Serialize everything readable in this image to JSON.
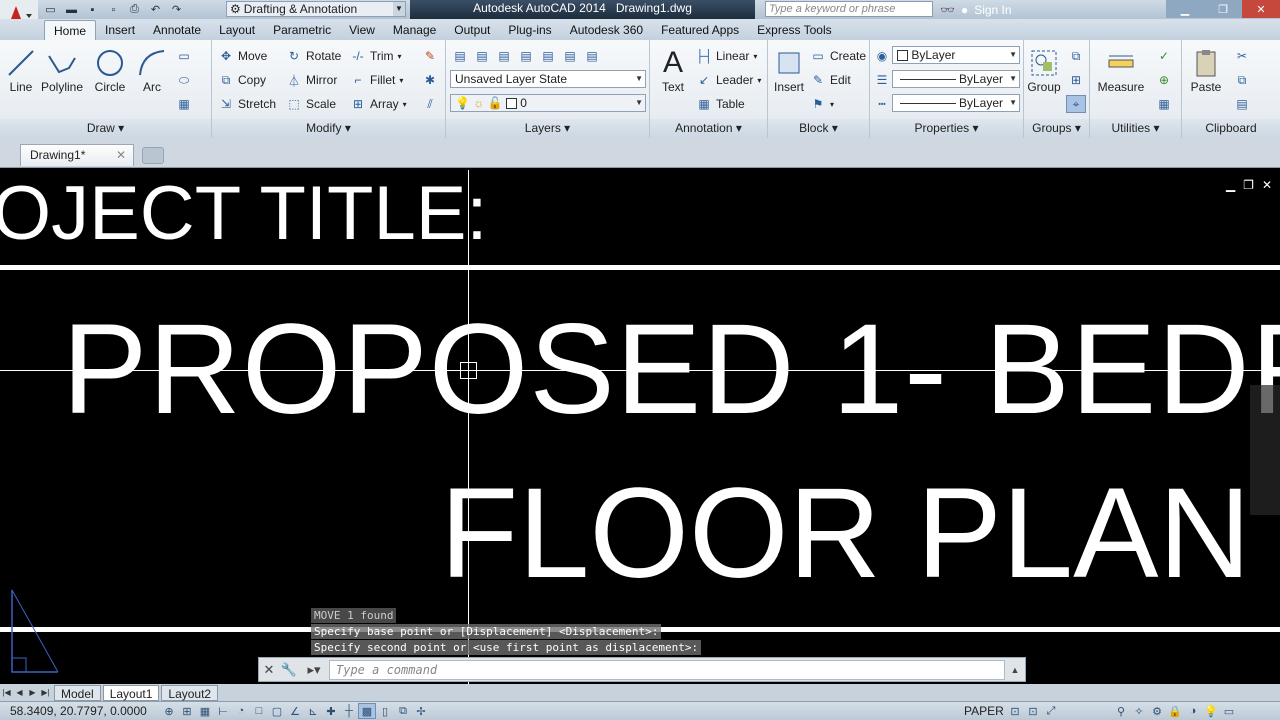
{
  "app": {
    "title": "Autodesk AutoCAD 2014",
    "file": "Drawing1.dwg"
  },
  "workspace": "Drafting & Annotation",
  "search": {
    "placeholder": "Type a keyword or phrase"
  },
  "signin": "Sign In",
  "tabs": [
    "Home",
    "Insert",
    "Annotate",
    "Layout",
    "Parametric",
    "View",
    "Manage",
    "Output",
    "Plug-ins",
    "Autodesk 360",
    "Featured Apps",
    "Express Tools"
  ],
  "draw": {
    "title": "Draw",
    "line": "Line",
    "polyline": "Polyline",
    "circle": "Circle",
    "arc": "Arc"
  },
  "modify": {
    "title": "Modify",
    "move": "Move",
    "rotate": "Rotate",
    "trim": "Trim",
    "copy": "Copy",
    "mirror": "Mirror",
    "fillet": "Fillet",
    "stretch": "Stretch",
    "scale": "Scale",
    "array": "Array"
  },
  "layers": {
    "title": "Layers",
    "state": "Unsaved Layer State",
    "current": "0"
  },
  "annotation": {
    "title": "Annotation",
    "text": "Text",
    "linear": "Linear",
    "leader": "Leader",
    "table": "Table"
  },
  "block": {
    "title": "Block",
    "insert": "Insert",
    "create": "Create",
    "edit": "Edit"
  },
  "properties": {
    "title": "Properties",
    "color": "ByLayer",
    "linetype": "ByLayer",
    "lineweight": "ByLayer"
  },
  "groups": {
    "title": "Groups",
    "group": "Group"
  },
  "utilities": {
    "title": "Utilities",
    "measure": "Measure"
  },
  "clipboard": {
    "title": "Clipboard",
    "paste": "Paste"
  },
  "doc_tab": "Drawing1*",
  "drawing": {
    "line1": "OJECT TITLE:",
    "line2": "PROPOSED 1- BEDR",
    "line3": "FLOOR PLAN"
  },
  "command": {
    "history": [
      "MOVE 1 found",
      "Specify base point or [Displacement] <Displacement>:",
      "Specify second point or <use first point as displacement>:"
    ],
    "placeholder": "Type a command"
  },
  "layout_tabs": [
    "Model",
    "Layout1",
    "Layout2"
  ],
  "status": {
    "coords": "58.3409, 20.7797, 0.0000",
    "space": "PAPER"
  }
}
